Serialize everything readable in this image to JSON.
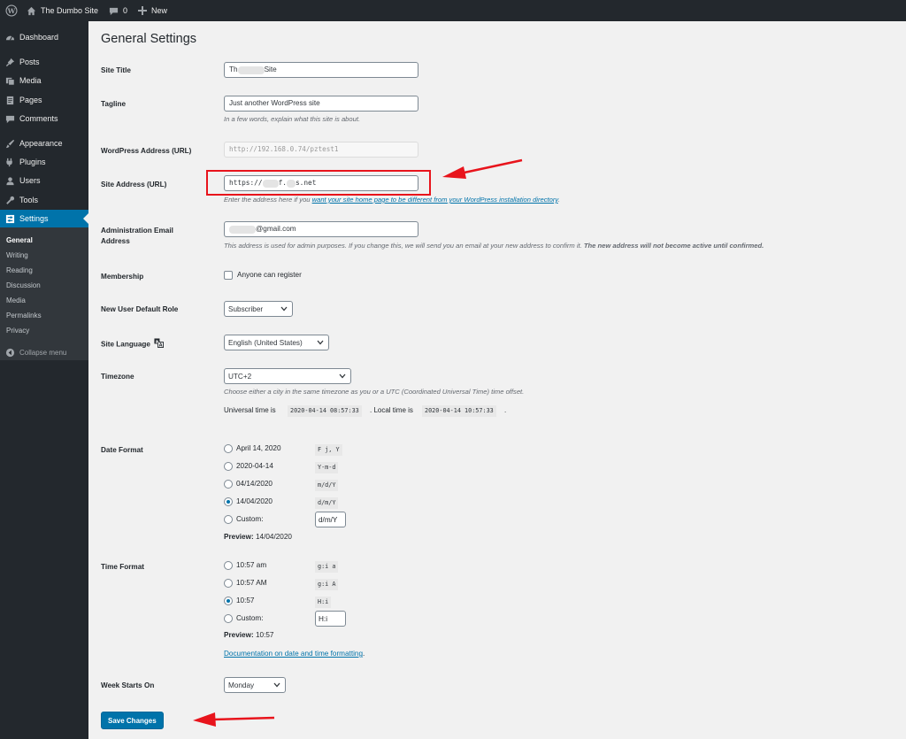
{
  "admin_bar": {
    "site_name": "The Dumbo Site",
    "comments_count": "0",
    "new_label": "New"
  },
  "side_menu": {
    "items": [
      {
        "label": "Dashboard",
        "icon": "dashboard-icon"
      },
      {
        "label": "Posts",
        "icon": "pin-icon"
      },
      {
        "label": "Media",
        "icon": "media-icon"
      },
      {
        "label": "Pages",
        "icon": "page-icon"
      },
      {
        "label": "Comments",
        "icon": "comment-icon"
      },
      {
        "label": "Appearance",
        "icon": "brush-icon"
      },
      {
        "label": "Plugins",
        "icon": "plugin-icon"
      },
      {
        "label": "Users",
        "icon": "user-icon"
      },
      {
        "label": "Tools",
        "icon": "wrench-icon"
      },
      {
        "label": "Settings",
        "icon": "settings-icon"
      }
    ],
    "submenu": [
      "General",
      "Writing",
      "Reading",
      "Discussion",
      "Media",
      "Permalinks",
      "Privacy"
    ],
    "collapse_label": "Collapse menu"
  },
  "page": {
    "title": "General Settings",
    "site_title": {
      "label": "Site Title",
      "value_prefix": "Th",
      "value_suffix": "Site"
    },
    "tagline": {
      "label": "Tagline",
      "value": "Just another WordPress site",
      "description": "In a few words, explain what this site is about."
    },
    "wp_address": {
      "label": "WordPress Address (URL)",
      "value": "http://192.168.0.74/pztest1"
    },
    "site_address": {
      "label": "Site Address (URL)",
      "value_parts": [
        "https://",
        "f.",
        "s.net"
      ],
      "description_before": "Enter the address here if you ",
      "description_link": "want your site home page to be different from your WordPress installation directory",
      "description_after": "."
    },
    "admin_email": {
      "label_line1": "Administration Email",
      "label_line2": "Address",
      "value_suffix": "@gmail.com",
      "description_normal": "This address is used for admin purposes. If you change this, we will send you an email at your new address to confirm it. ",
      "description_bold": "The new address will not become active until confirmed."
    },
    "membership": {
      "label": "Membership",
      "checkbox_label": "Anyone can register",
      "checked": false
    },
    "default_role": {
      "label": "New User Default Role",
      "selected": "Subscriber"
    },
    "site_language": {
      "label": "Site Language",
      "selected": "English (United States)"
    },
    "timezone": {
      "label": "Timezone",
      "selected": "UTC+2",
      "description": "Choose either a city in the same timezone as you or a UTC (Coordinated Universal Time) time offset.",
      "universal_label": "Universal time is ",
      "universal_time": "2020-04-14 08:57:33",
      "local_label": ". Local time is ",
      "local_time": "2020-04-14 10:57:33",
      "end": "."
    },
    "date_format": {
      "label": "Date Format",
      "options": [
        {
          "label": "April 14, 2020",
          "code": "F j, Y",
          "checked": false
        },
        {
          "label": "2020-04-14",
          "code": "Y-m-d",
          "checked": false
        },
        {
          "label": "04/14/2020",
          "code": "m/d/Y",
          "checked": false
        },
        {
          "label": "14/04/2020",
          "code": "d/m/Y",
          "checked": true
        }
      ],
      "custom_label": "Custom:",
      "custom_value": "d/m/Y",
      "preview_label": "Preview:",
      "preview_value": " 14/04/2020"
    },
    "time_format": {
      "label": "Time Format",
      "options": [
        {
          "label": "10:57 am",
          "code": "g:i a",
          "checked": false
        },
        {
          "label": "10:57 AM",
          "code": "g:i A",
          "checked": false
        },
        {
          "label": "10:57",
          "code": "H:i",
          "checked": true
        }
      ],
      "custom_label": "Custom:",
      "custom_value": "H:i",
      "preview_label": "Preview:",
      "preview_value": " 10:57",
      "doc_link": "Documentation on date and time formatting",
      "doc_after": "."
    },
    "week_starts": {
      "label": "Week Starts On",
      "selected": "Monday"
    },
    "save_label": "Save Changes"
  },
  "colors": {
    "admin_dark": "#23282d",
    "accent": "#0073aa",
    "annotation_red": "#e8141c"
  }
}
